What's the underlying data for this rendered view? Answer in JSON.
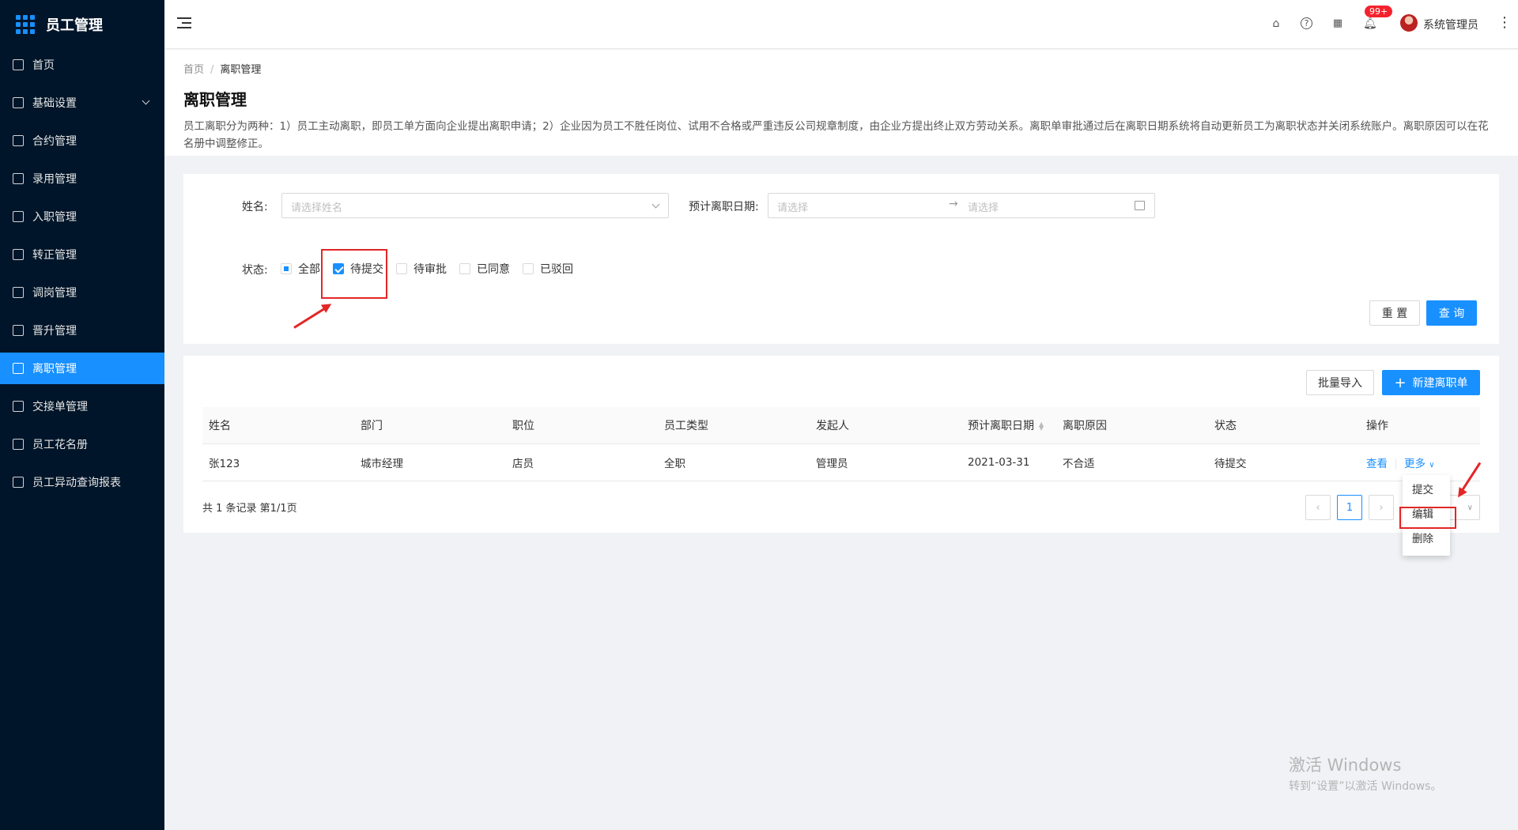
{
  "app": {
    "title": "员工管理"
  },
  "sidebar": {
    "items": [
      {
        "label": "首页",
        "icon": "home-icon"
      },
      {
        "label": "基础设置",
        "icon": "mail-icon",
        "expandable": true
      },
      {
        "label": "合约管理",
        "icon": "calendar-icon"
      },
      {
        "label": "录用管理",
        "icon": "table-icon"
      },
      {
        "label": "入职管理",
        "icon": "file-icon"
      },
      {
        "label": "转正管理",
        "icon": "grid-icon"
      },
      {
        "label": "调岗管理",
        "icon": "user-icon"
      },
      {
        "label": "晋升管理",
        "icon": "doc-icon"
      },
      {
        "label": "离职管理",
        "icon": "user-leave-icon",
        "active": true
      },
      {
        "label": "交接单管理",
        "icon": "copy-icon"
      },
      {
        "label": "员工花名册",
        "icon": "roster-icon"
      },
      {
        "label": "员工异动查询报表",
        "icon": "report-icon"
      }
    ]
  },
  "header": {
    "notification_badge": "99+",
    "username": "系统管理员",
    "icons": [
      "home-icon",
      "help-icon",
      "apps-icon",
      "bell-icon",
      "more-vertical-icon"
    ]
  },
  "breadcrumb": {
    "home": "首页",
    "separator": "/",
    "current": "离职管理"
  },
  "page": {
    "title": "离职管理",
    "description": "员工离职分为两种：1）员工主动离职，即员工单方面向企业提出离职申请；2）企业因为员工不胜任岗位、试用不合格或严重违反公司规章制度，由企业方提出终止双方劳动关系。离职单审批通过后在离职日期系统将自动更新员工为离职状态并关闭系统账户。离职原因可以在花名册中调整修正。"
  },
  "filters": {
    "name_label": "姓名:",
    "name_placeholder": "请选择姓名",
    "date_label": "预计离职日期:",
    "date_start_placeholder": "请选择",
    "date_end_placeholder": "请选择",
    "date_separator": "→",
    "status_label": "状态:",
    "status_options": [
      {
        "label": "全部",
        "state": "indeterminate"
      },
      {
        "label": "待提交",
        "state": "checked"
      },
      {
        "label": "待审批",
        "state": "unchecked"
      },
      {
        "label": "已同意",
        "state": "unchecked"
      },
      {
        "label": "已驳回",
        "state": "unchecked"
      }
    ],
    "reset_label": "重 置",
    "query_label": "查 询"
  },
  "toolbar": {
    "import_label": "批量导入",
    "new_label": "新建离职单",
    "new_icon": "+"
  },
  "table": {
    "columns": [
      "姓名",
      "部门",
      "职位",
      "员工类型",
      "发起人",
      "预计离职日期",
      "离职原因",
      "状态",
      "操作"
    ],
    "rows": [
      {
        "name": "张123",
        "dept": "城市经理",
        "position": "店员",
        "type": "全职",
        "initiator": "管理员",
        "date": "2021-03-31",
        "reason": "不合适",
        "status": "待提交",
        "view": "查看",
        "more": "更多"
      }
    ]
  },
  "pagination": {
    "summary": "共 1 条记录 第1/1页",
    "current_page": "1",
    "prev": "‹",
    "next": "›"
  },
  "more_menu": {
    "items": [
      "提交",
      "编辑",
      "删除"
    ]
  },
  "watermark": {
    "line1": "激活 Windows",
    "line2": "转到“设置”以激活 Windows。"
  },
  "colors": {
    "primary": "#1890ff",
    "sidebar_bg": "#001529",
    "annotation": "#e32626"
  }
}
